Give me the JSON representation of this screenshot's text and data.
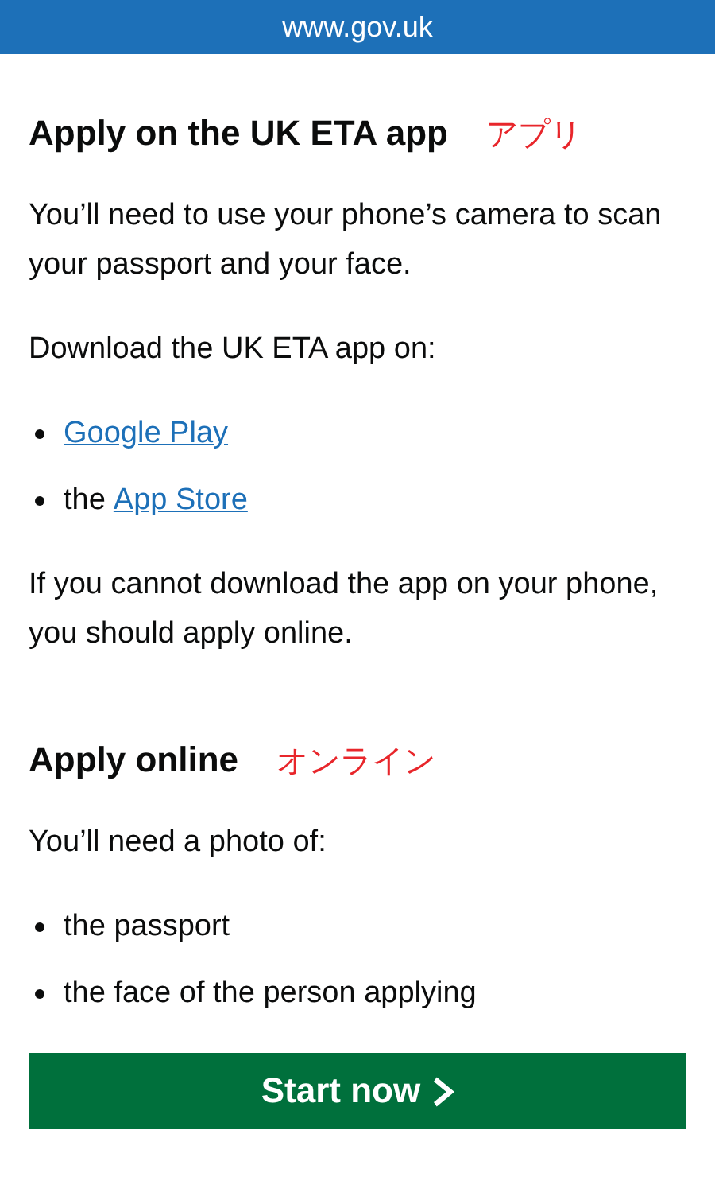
{
  "address_bar": {
    "url": "www.gov.uk"
  },
  "sections": [
    {
      "heading": "Apply on the UK ETA app",
      "annotation": "アプリ",
      "blocks": [
        {
          "kind": "paragraph",
          "text": "You’ll need to use your phone’s camera to scan your passport and your face."
        },
        {
          "kind": "paragraph",
          "text": "Download the UK ETA app on:"
        },
        {
          "kind": "list",
          "items": [
            {
              "link": "Google Play"
            },
            {
              "text": "the",
              "link": "App Store"
            }
          ]
        },
        {
          "kind": "paragraph",
          "text": "If you cannot download the app on your phone, you should apply online."
        }
      ]
    },
    {
      "heading": "Apply online",
      "annotation": "オンライン",
      "blocks": [
        {
          "kind": "paragraph",
          "text": "You’ll need a photo of:"
        },
        {
          "kind": "list",
          "items": [
            {
              "text": "the passport"
            },
            {
              "text": "the face of the person applying"
            }
          ]
        }
      ]
    }
  ],
  "start_button": {
    "label": "Start now"
  }
}
